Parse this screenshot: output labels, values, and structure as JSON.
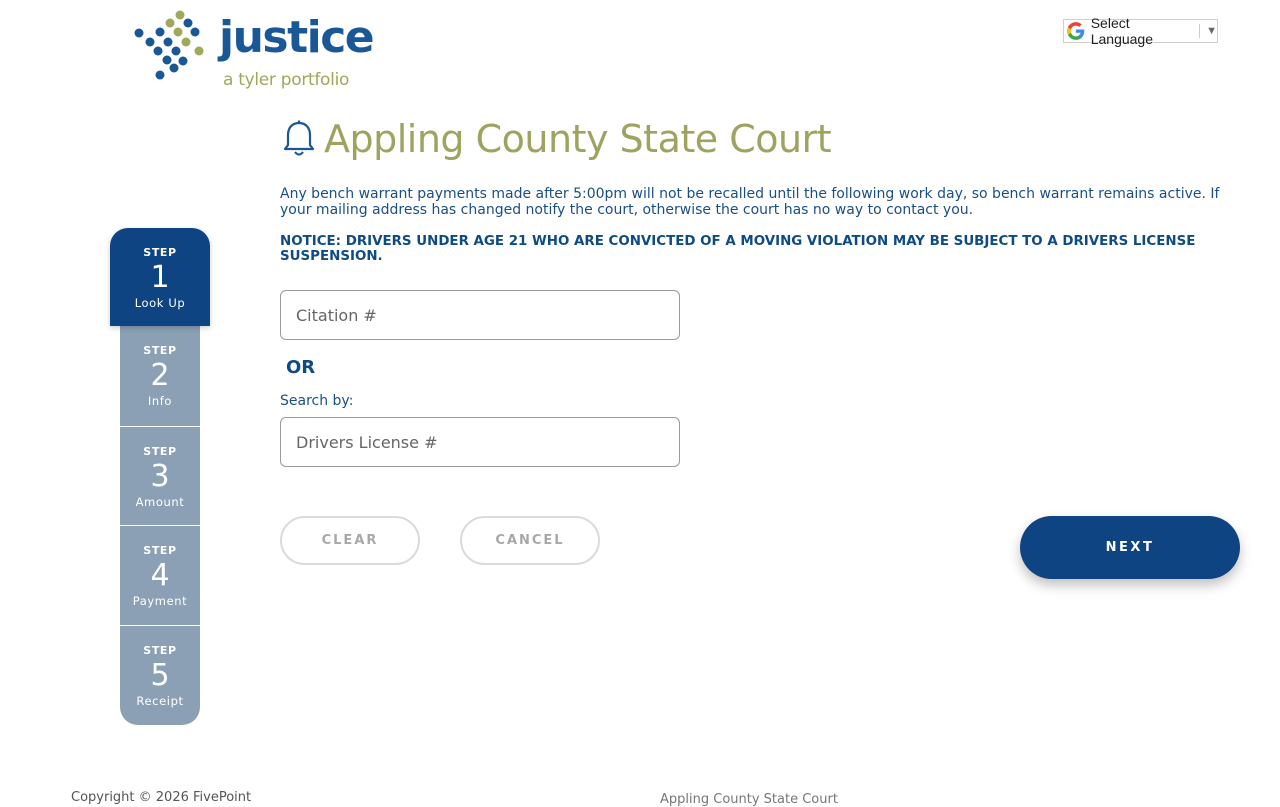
{
  "header": {
    "logo_word": "justice",
    "logo_sub": "a tyler portfolio",
    "language_label": "Select Language",
    "language_arrow": "▼"
  },
  "page": {
    "title": "Appling County State Court",
    "info": "Any bench warrant payments made after 5:00pm will not be recalled until the following work day, so bench warrant remains active. If your mailing address has changed notify the court, otherwise the court has no way to contact you.",
    "notice": "NOTICE: DRIVERS UNDER AGE 21 WHO ARE CONVICTED OF A MOVING VIOLATION MAY BE SUBJECT TO A DRIVERS LICENSE SUSPENSION."
  },
  "form": {
    "citation_placeholder": "Citation #",
    "citation_value": "",
    "or_label": "OR",
    "search_by_label": "Search by:",
    "license_placeholder": "Drivers License #",
    "license_value": ""
  },
  "buttons": {
    "clear": "CLEAR",
    "cancel": "CANCEL",
    "next": "NEXT"
  },
  "steps": [
    {
      "label": "STEP",
      "number": "1",
      "name": "Look Up",
      "active": true
    },
    {
      "label": "STEP",
      "number": "2",
      "name": "Info",
      "active": false
    },
    {
      "label": "STEP",
      "number": "3",
      "name": "Amount",
      "active": false
    },
    {
      "label": "STEP",
      "number": "4",
      "name": "Payment",
      "active": false
    },
    {
      "label": "STEP",
      "number": "5",
      "name": "Receipt",
      "active": false
    }
  ],
  "footer": {
    "copyright": "Copyright © 2026 FivePoint",
    "court": "Appling County State Court"
  },
  "colors": {
    "primary": "#0e4482",
    "inactive_step": "#8ba0b5",
    "title": "#9ea460"
  }
}
